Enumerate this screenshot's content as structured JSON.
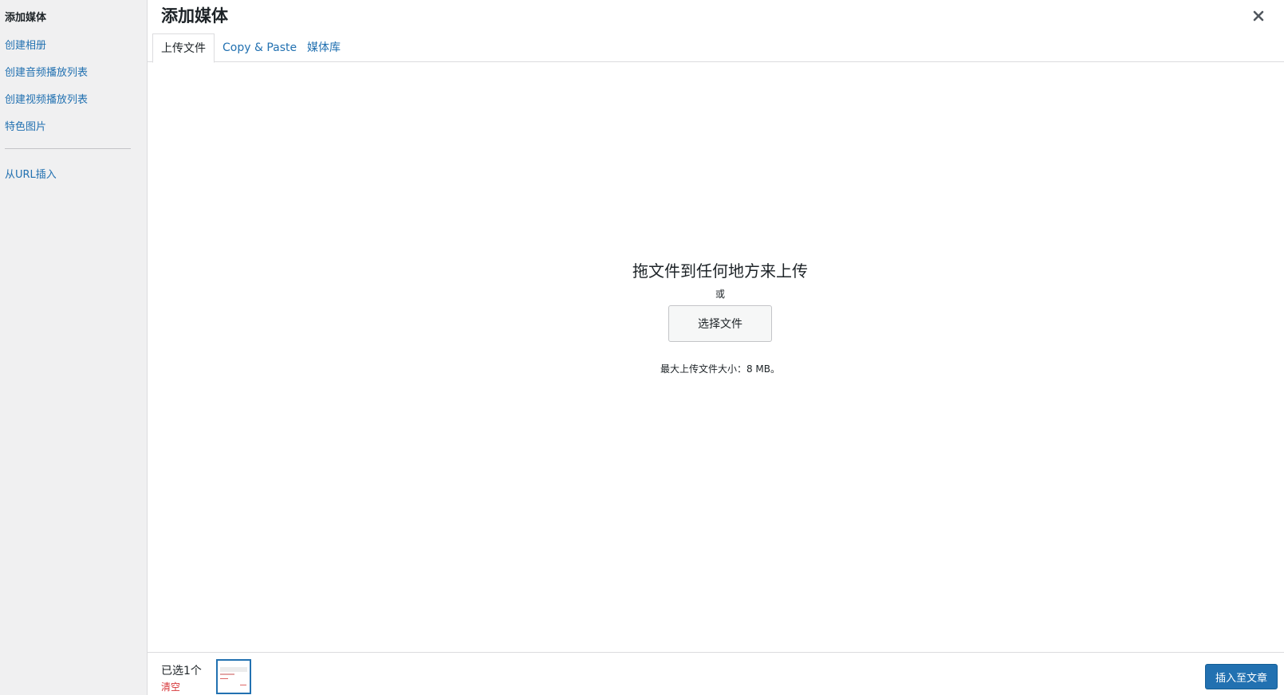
{
  "sidebar": {
    "title": "添加媒体",
    "links": [
      "创建相册",
      "创建音频播放列表",
      "创建视频播放列表",
      "特色图片"
    ],
    "url_link": "从URL插入"
  },
  "header": {
    "title": "添加媒体",
    "tabs": [
      "上传文件",
      "Copy & Paste",
      "媒体库"
    ],
    "active_tab": "上传文件"
  },
  "upload": {
    "drop_text": "拖文件到任何地方来上传",
    "or_text": "或",
    "select_button": "选择文件",
    "max_size": "最大上传文件大小：8 MB。"
  },
  "footer": {
    "selected_count": "已选1个",
    "clear_label": "清空",
    "insert_button": "插入至文章"
  },
  "colors": {
    "link": "#2271b1",
    "primary": "#2271b1",
    "danger": "#d63638",
    "sidebar_bg": "#f0f0f1"
  }
}
